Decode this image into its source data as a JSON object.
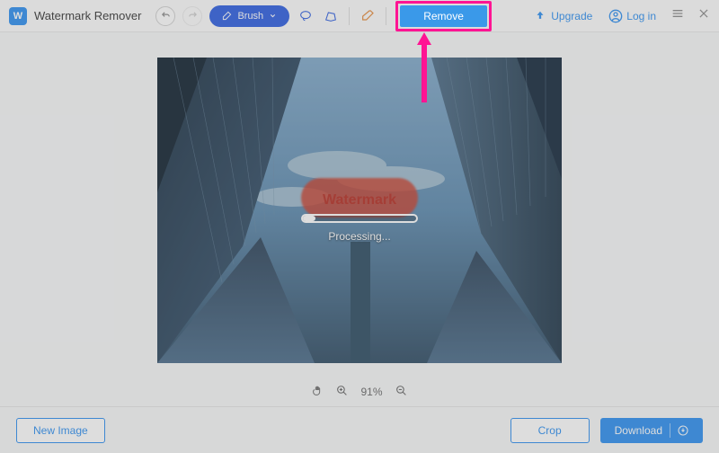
{
  "app": {
    "title": "Watermark Remover"
  },
  "toolbar": {
    "brush_label": "Brush",
    "remove_label": "Remove",
    "upgrade_label": "Upgrade",
    "login_label": "Log in"
  },
  "processing": {
    "status": "Processing...",
    "watermark_text": "Watermark"
  },
  "zoom": {
    "level": "91%"
  },
  "footer": {
    "new_image": "New Image",
    "crop": "Crop",
    "download": "Download"
  }
}
